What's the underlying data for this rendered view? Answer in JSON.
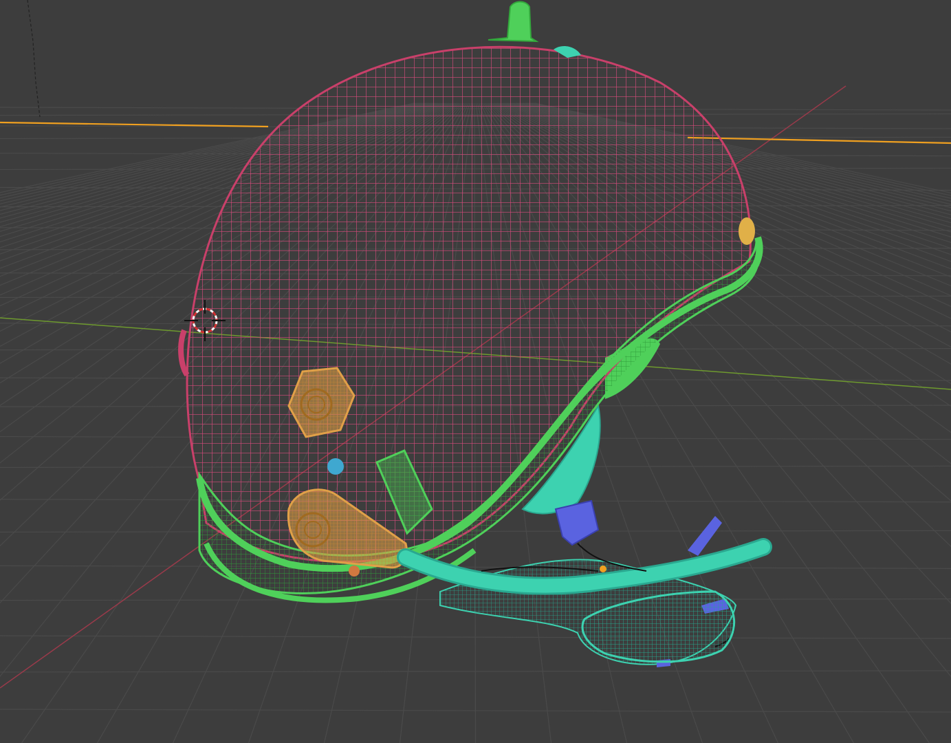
{
  "viewport": {
    "background": "#3d3d3d",
    "grid_line_color": "#4a4a4a",
    "axis_x_color": "#b04a58",
    "axis_y_color": "#7da63a",
    "horizon_highlight_color": "#f0a020"
  },
  "scene": {
    "objects": [
      {
        "name": "helmet-shell",
        "display": "wireframe",
        "color": "#c9406a"
      },
      {
        "name": "helmet-rim",
        "display": "wireframe",
        "color": "#4fd05a"
      },
      {
        "name": "top-fin",
        "display": "solid",
        "color": "#4fd05a"
      },
      {
        "name": "ear-cups",
        "display": "wireframe",
        "color": "#e0a048"
      },
      {
        "name": "chin-strap",
        "display": "wireframe",
        "color": "#3dd2b0"
      },
      {
        "name": "microphone-boom",
        "display": "solid",
        "color": "#3dd2b0"
      },
      {
        "name": "visor-clip",
        "display": "solid",
        "color": "#5a63e0"
      },
      {
        "name": "side-plate",
        "display": "wireframe",
        "color": "#4fd05a"
      }
    ],
    "cursor_icon": "3d-cursor-icon",
    "light_icon": "light-dot-icon"
  }
}
